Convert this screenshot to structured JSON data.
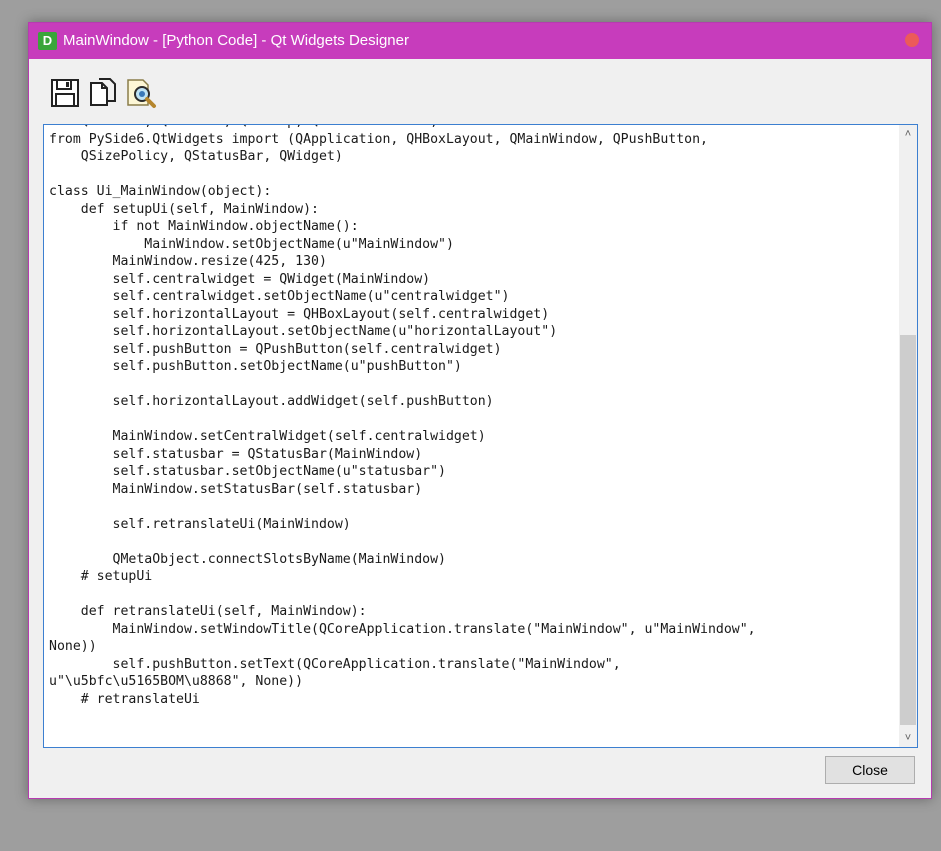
{
  "window": {
    "title": "MainWindow - [Python Code] - Qt Widgets Designer",
    "app_icon_letter": "D"
  },
  "toolbar": {
    "buttons": [
      {
        "icon": "save-icon",
        "label": ""
      },
      {
        "icon": "copy-icon",
        "label": ""
      },
      {
        "icon": "find-icon",
        "label": ""
      }
    ]
  },
  "editor": {
    "lines": [
      "    QPainter, QPalette, QPixmap, QRadialGradient,",
      "from PySide6.QtWidgets import (QApplication, QHBoxLayout, QMainWindow, QPushButton,",
      "    QSizePolicy, QStatusBar, QWidget)",
      "",
      "class Ui_MainWindow(object):",
      "    def setupUi(self, MainWindow):",
      "        if not MainWindow.objectName():",
      "            MainWindow.setObjectName(u\"MainWindow\")",
      "        MainWindow.resize(425, 130)",
      "        self.centralwidget = QWidget(MainWindow)",
      "        self.centralwidget.setObjectName(u\"centralwidget\")",
      "        self.horizontalLayout = QHBoxLayout(self.centralwidget)",
      "        self.horizontalLayout.setObjectName(u\"horizontalLayout\")",
      "        self.pushButton = QPushButton(self.centralwidget)",
      "        self.pushButton.setObjectName(u\"pushButton\")",
      "",
      "        self.horizontalLayout.addWidget(self.pushButton)",
      "",
      "        MainWindow.setCentralWidget(self.centralwidget)",
      "        self.statusbar = QStatusBar(MainWindow)",
      "        self.statusbar.setObjectName(u\"statusbar\")",
      "        MainWindow.setStatusBar(self.statusbar)",
      "",
      "        self.retranslateUi(MainWindow)",
      "",
      "        QMetaObject.connectSlotsByName(MainWindow)",
      "    # setupUi",
      "",
      "    def retranslateUi(self, MainWindow):",
      "        MainWindow.setWindowTitle(QCoreApplication.translate(\"MainWindow\", u\"MainWindow\",",
      "None))",
      "        self.pushButton.setText(QCoreApplication.translate(\"MainWindow\",",
      "u\"\\u5bfc\\u5165BOM\\u8868\", None))",
      "    # retranslateUi"
    ]
  },
  "footer": {
    "close_label": "Close"
  }
}
